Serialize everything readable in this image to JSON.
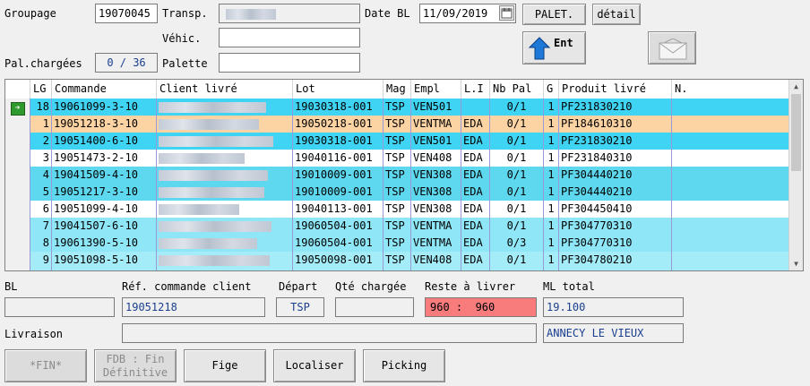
{
  "header": {
    "groupage_label": "Groupage",
    "groupage_value": "19070045",
    "transp_label": "Transp.",
    "date_label": "Date BL",
    "date_value": "11/09/2019",
    "palet_button": "PALET.",
    "detail_button": "détail",
    "vehic_label": "Véhic.",
    "pal_chargees_label": "Pal.chargées",
    "pal_chargees_value": "0 / 36",
    "palette_label": "Palette",
    "ent_button": "Ent"
  },
  "grid": {
    "columns": [
      "LG",
      "Commande",
      "Client livré",
      "Lot",
      "Mag",
      "Empl",
      "L.I",
      "Nb Pal",
      "G",
      "Produit livré",
      "N."
    ],
    "rows": [
      {
        "lg": "18",
        "commande": "19061099-3-10",
        "lot": "19030318-001",
        "mag": "TSP",
        "empl": "VEN501",
        "li": "",
        "nbpal": "0/1",
        "g": "1",
        "produit": "PF231830210",
        "color": "#40d4f4",
        "current": true
      },
      {
        "lg": "1",
        "commande": "19051218-3-10",
        "lot": "19050218-001",
        "mag": "TSP",
        "empl": "VENTMA",
        "li": "EDA",
        "nbpal": "0/1",
        "g": "1",
        "produit": "PF184610310",
        "color": "#fcd3a3"
      },
      {
        "lg": "2",
        "commande": "19051400-6-10",
        "lot": "19030318-001",
        "mag": "TSP",
        "empl": "VEN501",
        "li": "EDA",
        "nbpal": "0/1",
        "g": "1",
        "produit": "PF231830210",
        "color": "#40d4f4"
      },
      {
        "lg": "3",
        "commande": "19051473-2-10",
        "lot": "19040116-001",
        "mag": "TSP",
        "empl": "VEN408",
        "li": "EDA",
        "nbpal": "0/1",
        "g": "1",
        "produit": "PF231840310",
        "color": "#ffffff"
      },
      {
        "lg": "4",
        "commande": "19041509-4-10",
        "lot": "19010009-001",
        "mag": "TSP",
        "empl": "VEN308",
        "li": "EDA",
        "nbpal": "0/1",
        "g": "1",
        "produit": "PF304440210",
        "color": "#5ed8ee"
      },
      {
        "lg": "5",
        "commande": "19051217-3-10",
        "lot": "19010009-001",
        "mag": "TSP",
        "empl": "VEN308",
        "li": "EDA",
        "nbpal": "0/1",
        "g": "1",
        "produit": "PF304440210",
        "color": "#5ed8ee"
      },
      {
        "lg": "6",
        "commande": "19051099-4-10",
        "lot": "19040113-001",
        "mag": "TSP",
        "empl": "VEN308",
        "li": "EDA",
        "nbpal": "0/1",
        "g": "1",
        "produit": "PF304450410",
        "color": "#ffffff"
      },
      {
        "lg": "7",
        "commande": "19041507-6-10",
        "lot": "19060504-001",
        "mag": "TSP",
        "empl": "VENTMA",
        "li": "EDA",
        "nbpal": "0/1",
        "g": "1",
        "produit": "PF304770310",
        "color": "#8ee6f6"
      },
      {
        "lg": "8",
        "commande": "19061390-5-10",
        "lot": "19060504-001",
        "mag": "TSP",
        "empl": "VENTMA",
        "li": "EDA",
        "nbpal": "0/3",
        "g": "1",
        "produit": "PF304770310",
        "color": "#8ee6f6"
      },
      {
        "lg": "9",
        "commande": "19051098-5-10",
        "lot": "19050098-001",
        "mag": "TSP",
        "empl": "VEN408",
        "li": "EDA",
        "nbpal": "0/1",
        "g": "1",
        "produit": "PF304780210",
        "color": "#a4ecf8"
      },
      {
        "lg": "",
        "commande": "",
        "lot": "",
        "mag": "",
        "empl": "",
        "li": "",
        "nbpal": "",
        "g": "",
        "produit": "",
        "color": "#a4ecf8"
      }
    ]
  },
  "footer": {
    "bl_label": "BL",
    "ref_label": "Réf. commande client",
    "ref_value": "19051218",
    "depart_label": "Départ",
    "depart_value": "TSP",
    "qte_label": "Qté chargée",
    "reste_label": "Reste à livrer",
    "reste_value": "960 :  960",
    "reste_color": "#f87c7c",
    "ml_label": "ML total",
    "ml_value": "19.100",
    "livraison_label": "Livraison",
    "ville_value": "ANNECY LE VIEUX",
    "fin_button": "*FIN*",
    "fdb_button_line1": "FDB : Fin",
    "fdb_button_line2": "Définitive",
    "fige_button": "Fige",
    "localiser_button": "Localiser",
    "picking_button": "Picking"
  },
  "icons": [
    "row-pointer-icon",
    "up-arrow-icon",
    "envelope-icon",
    "calendar-icon"
  ]
}
